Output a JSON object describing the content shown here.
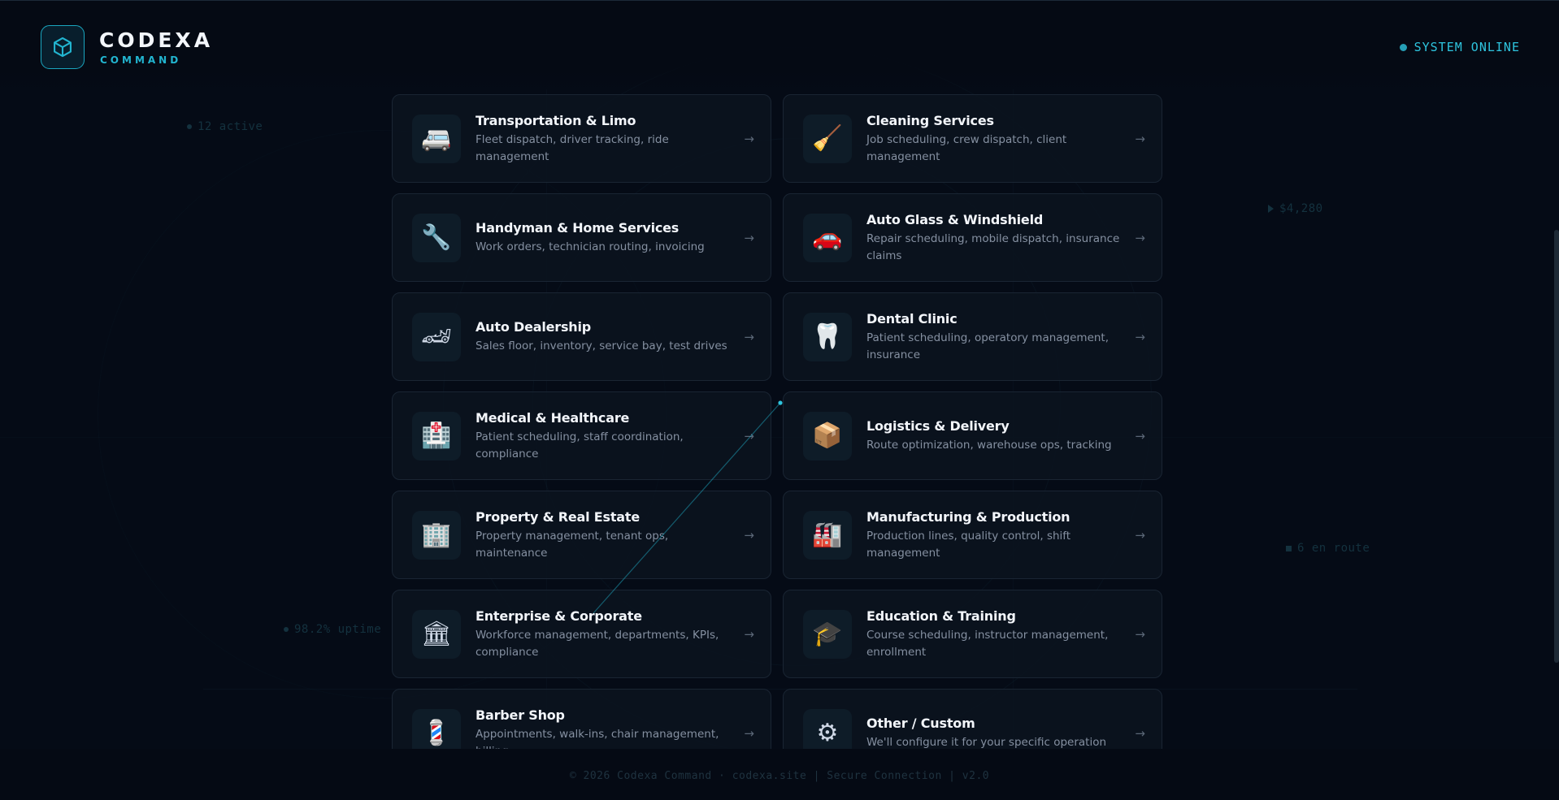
{
  "brand": {
    "name": "CODEXA",
    "subtitle": "COMMAND"
  },
  "status": {
    "label": "SYSTEM ONLINE"
  },
  "background_stats": [
    {
      "text": "12 active"
    },
    {
      "text": "$4,280"
    },
    {
      "text": "6 en route"
    },
    {
      "text": "98.2% uptime"
    }
  ],
  "industries": [
    {
      "title": "Transportation & Limo",
      "description": "Fleet dispatch, driver tracking, ride management",
      "icon": "minibus-icon",
      "glyph": "🚐"
    },
    {
      "title": "Cleaning Services",
      "description": "Job scheduling, crew dispatch, client management",
      "icon": "broom-icon",
      "glyph": "🧹"
    },
    {
      "title": "Handyman & Home Services",
      "description": "Work orders, technician routing, invoicing",
      "icon": "wrench-icon",
      "glyph": "🔧"
    },
    {
      "title": "Auto Glass & Windshield",
      "description": "Repair scheduling, mobile dispatch, insurance claims",
      "icon": "car-icon",
      "glyph": "🚗"
    },
    {
      "title": "Auto Dealership",
      "description": "Sales floor, inventory, service bay, test drives",
      "icon": "race-car-icon",
      "glyph": "🏎"
    },
    {
      "title": "Dental Clinic",
      "description": "Patient scheduling, operatory management, insurance",
      "icon": "tooth-icon",
      "glyph": "🦷"
    },
    {
      "title": "Medical & Healthcare",
      "description": "Patient scheduling, staff coordination, compliance",
      "icon": "hospital-icon",
      "glyph": "🏥"
    },
    {
      "title": "Logistics & Delivery",
      "description": "Route optimization, warehouse ops, tracking",
      "icon": "package-icon",
      "glyph": "📦"
    },
    {
      "title": "Property & Real Estate",
      "description": "Property management, tenant ops, maintenance",
      "icon": "office-building-icon",
      "glyph": "🏢"
    },
    {
      "title": "Manufacturing & Production",
      "description": "Production lines, quality control, shift management",
      "icon": "factory-icon",
      "glyph": "🏭"
    },
    {
      "title": "Enterprise & Corporate",
      "description": "Workforce management, departments, KPIs, compliance",
      "icon": "classical-building-icon",
      "glyph": "🏛"
    },
    {
      "title": "Education & Training",
      "description": "Course scheduling, instructor management, enrollment",
      "icon": "graduation-cap-icon",
      "glyph": "🎓"
    },
    {
      "title": "Barber Shop",
      "description": "Appointments, walk-ins, chair management, billing",
      "icon": "barber-pole-icon",
      "glyph": "💈"
    },
    {
      "title": "Other / Custom",
      "description": "We'll configure it for your specific operation",
      "icon": "gear-icon",
      "glyph": "⚙"
    }
  ],
  "card_arrow": "→",
  "footer": {
    "text": "© 2026 Codexa Command · codexa.site  |  Secure Connection  |  v2.0"
  }
}
